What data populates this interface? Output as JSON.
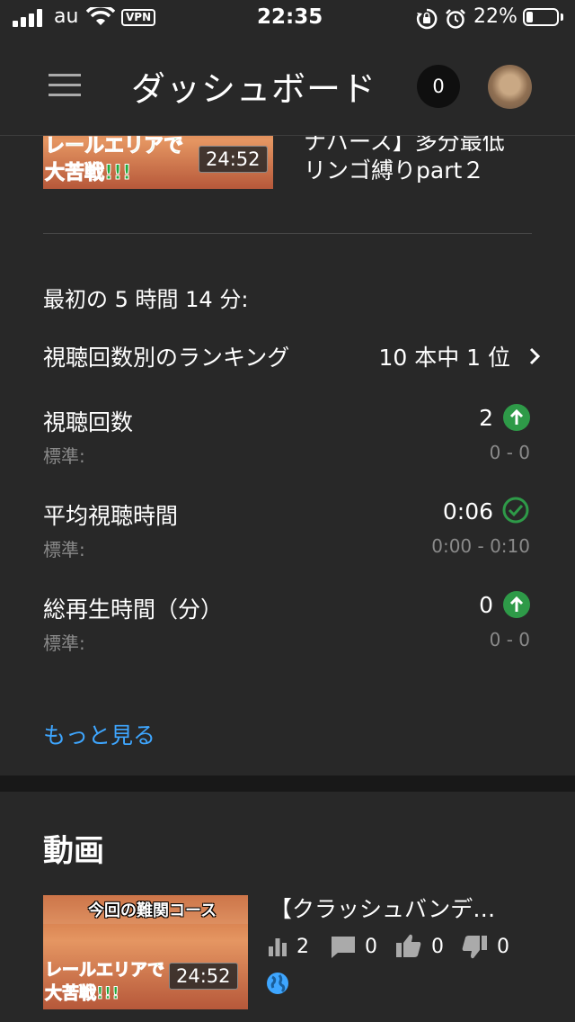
{
  "status_bar": {
    "carrier": "au",
    "vpn": "VPN",
    "time": "22:35",
    "battery_percent": "22%",
    "battery_level": 0.22,
    "icons": [
      "signal-icon",
      "wifi-icon",
      "vpn-icon",
      "orientation-lock-icon",
      "alarm-icon",
      "battery-icon"
    ]
  },
  "header": {
    "title": "ダッシュボード",
    "notification_count": "0",
    "menu_icon": "hamburger-menu-icon",
    "avatar": "avatar"
  },
  "top_video": {
    "thumbnail_caption": "レールエリアで\n大苦戦!!!",
    "duration": "24:52",
    "title_line1": "ナバース】多分最低",
    "title_line2": "リンゴ縛りpart２"
  },
  "stats": {
    "period_label": "最初の 5 時間 14 分:",
    "ranking_label": "視聴回数別のランキング",
    "ranking_value": "10 本中 1 位",
    "rows": [
      {
        "label": "視聴回数",
        "value": "2",
        "sub_label": "標準:",
        "sub_value": "0 - 0",
        "icon": "arrow-up-icon"
      },
      {
        "label": "平均視聴時間",
        "value": "0:06",
        "sub_label": "標準:",
        "sub_value": "0:00 - 0:10",
        "icon": "check-circle-icon"
      },
      {
        "label": "総再生時間（分）",
        "value": "0",
        "sub_label": "標準:",
        "sub_value": "0 - 0",
        "icon": "arrow-up-icon"
      }
    ],
    "more_link": "もっと見る"
  },
  "videos_section": {
    "title": "動画",
    "items": [
      {
        "thumbnail_top_caption": "今回の難関コース",
        "thumbnail_bottom_caption": "レールエリアで\n大苦戦!!!",
        "duration": "24:52",
        "title": "【クラッシュバンデ…",
        "views": "2",
        "comments": "0",
        "likes": "0",
        "dislikes": "0",
        "visibility_icon": "globe-icon"
      }
    ]
  },
  "colors": {
    "background": "#282828",
    "accent_link": "#3ea6ff",
    "status_good": "#2e9a48",
    "muted_text": "#8a8a8a"
  }
}
